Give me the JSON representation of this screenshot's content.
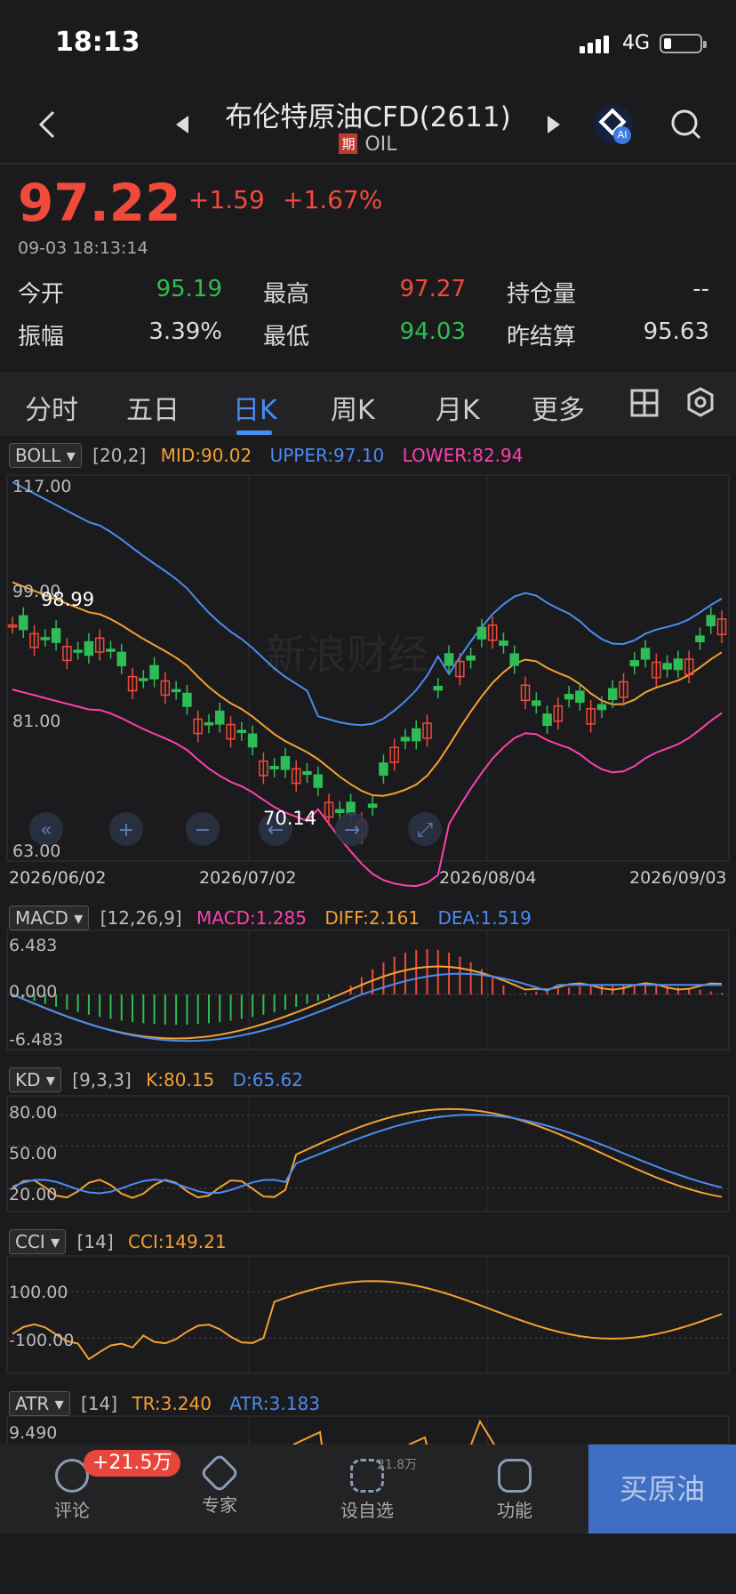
{
  "status_bar": {
    "time": "18:13",
    "network": "4G"
  },
  "header": {
    "title": "布伦特原油CFD(2611)",
    "tag": "期",
    "subtitle": "OIL",
    "ai_label": "AI"
  },
  "quote": {
    "price": "97.22",
    "change": "+1.59",
    "change_pct": "+1.67%",
    "timestamp": "09-03 18:13:14",
    "stats": [
      {
        "label": "今开",
        "value": "95.19",
        "color": "#2ebd55"
      },
      {
        "label": "最高",
        "value": "97.27",
        "color": "#f04a3a"
      },
      {
        "label": "持仓量",
        "value": "--",
        "color": "#dddddd"
      },
      {
        "label": "振幅",
        "value": "3.39%",
        "color": "#dddddd"
      },
      {
        "label": "最低",
        "value": "94.03",
        "color": "#2ebd55"
      },
      {
        "label": "昨结算",
        "value": "95.63",
        "color": "#dddddd"
      }
    ]
  },
  "tabs": [
    "分时",
    "五日",
    "日K",
    "周K",
    "月K",
    "更多"
  ],
  "active_tab": "日K",
  "boll": {
    "name": "BOLL",
    "params": "[20,2]",
    "mid": "MID:90.02",
    "upper": "UPPER:97.10",
    "lower": "LOWER:82.94",
    "y_labels": [
      "117.00",
      "99.00",
      "81.00",
      "63.00"
    ],
    "high_mark": "98.99",
    "low_mark": "70.14"
  },
  "dates": [
    "2026/06/02",
    "2026/07/02",
    "2026/08/04",
    "2026/09/03"
  ],
  "macd": {
    "name": "MACD",
    "params": "[12,26,9]",
    "macd": "MACD:1.285",
    "diff": "DIFF:2.161",
    "dea": "DEA:1.519",
    "y_labels": [
      "6.483",
      "0.000",
      "-6.483"
    ]
  },
  "kd": {
    "name": "KD",
    "params": "[9,3,3]",
    "k": "K:80.15",
    "d": "D:65.62",
    "y_labels": [
      "80.00",
      "50.00",
      "20.00"
    ]
  },
  "cci": {
    "name": "CCI",
    "params": "[14]",
    "cci": "CCI:149.21",
    "y_labels": [
      "100.00",
      "-100.00"
    ]
  },
  "atr": {
    "name": "ATR",
    "params": "[14]",
    "tr": "TR:3.240",
    "atr": "ATR:3.183",
    "y_labels": [
      "9.490"
    ]
  },
  "watermark": "新浪财经",
  "bottom_bar": {
    "comment": "评论",
    "comment_badge": "+21.5万",
    "expert": "专家",
    "watchlist": "设自选",
    "watchlist_count": "21.8万",
    "features": "功能",
    "buy": "买原油"
  },
  "colors": {
    "up": "#f04a3a",
    "down": "#2ebd55",
    "mid": "#f5a030",
    "upper": "#4a8cf0",
    "lower": "#ff40b0"
  }
}
